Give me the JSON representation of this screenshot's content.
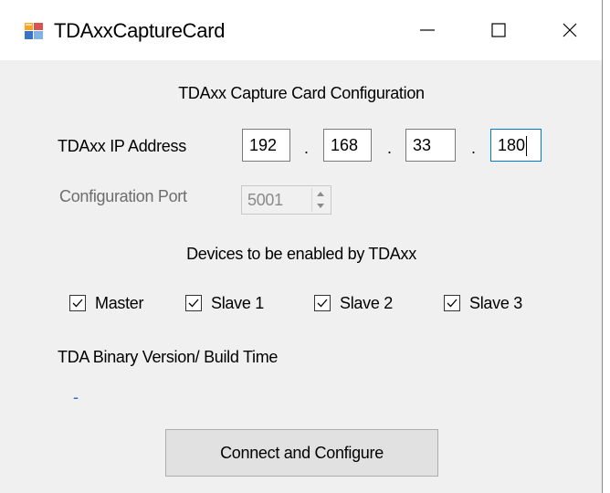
{
  "window": {
    "title": "TDAxxCaptureCard",
    "icon": "app-window-icon",
    "controls": [
      "minimize-icon",
      "maximize-icon",
      "close-icon"
    ]
  },
  "header": "TDAxx Capture Card Configuration",
  "ip": {
    "label": "TDAxx IP Address",
    "octets": [
      "192",
      "168",
      "33",
      "180"
    ],
    "separator": "."
  },
  "port": {
    "label": "Configuration Port",
    "value": "5001",
    "enabled": false
  },
  "devices": {
    "heading": "Devices to be enabled by TDAxx",
    "items": [
      {
        "label": "Master",
        "checked": true
      },
      {
        "label": "Slave 1",
        "checked": true
      },
      {
        "label": "Slave 2",
        "checked": true
      },
      {
        "label": "Slave 3",
        "checked": true
      }
    ]
  },
  "version": {
    "label": "TDA Binary Version/ Build Time",
    "value": "-"
  },
  "actions": {
    "connect_label": "Connect and Configure"
  },
  "colors": {
    "focus_border": "#0078d7",
    "value_text": "#1e6fd0",
    "window_bg": "#f0f0f0"
  }
}
